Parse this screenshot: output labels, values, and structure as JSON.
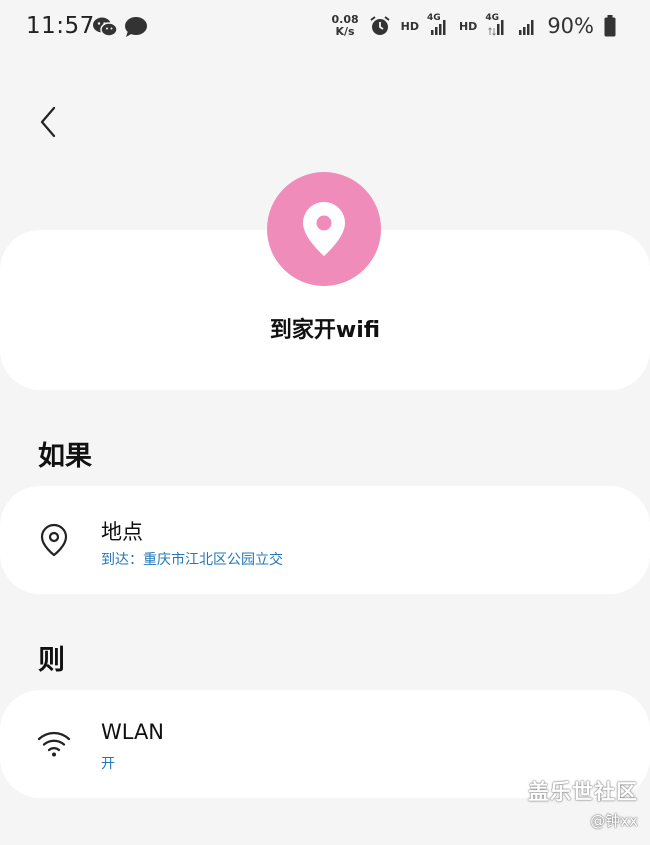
{
  "status_bar": {
    "time": "11:57",
    "net_speed_value": "0.08",
    "net_speed_unit": "K/s",
    "hd_label_1": "HD",
    "hd_label_2": "HD",
    "network_1": "4G",
    "network_2": "4G",
    "battery": "90%",
    "icons": [
      "wechat-icon",
      "message-icon",
      "alarm-icon",
      "signal-icon",
      "signal-icon",
      "battery-icon"
    ]
  },
  "header": {
    "back_icon": "chevron-left-icon",
    "badge_icon": "location-pin-icon",
    "badge_color": "#ef8cb9",
    "title": "到家开wifi"
  },
  "if_section": {
    "heading": "如果",
    "condition": {
      "icon": "location-pin-icon",
      "title": "地点",
      "subtitle": "到达：重庆市江北区公园立交"
    }
  },
  "then_section": {
    "heading": "则",
    "action": {
      "icon": "wifi-icon",
      "title": "WLAN",
      "subtitle": "开"
    }
  },
  "colors": {
    "background": "#f5f5f5",
    "card": "#ffffff",
    "accent_text": "#2477b8"
  },
  "watermark": {
    "main": "盖乐世社区",
    "sub": "@钟xx"
  }
}
